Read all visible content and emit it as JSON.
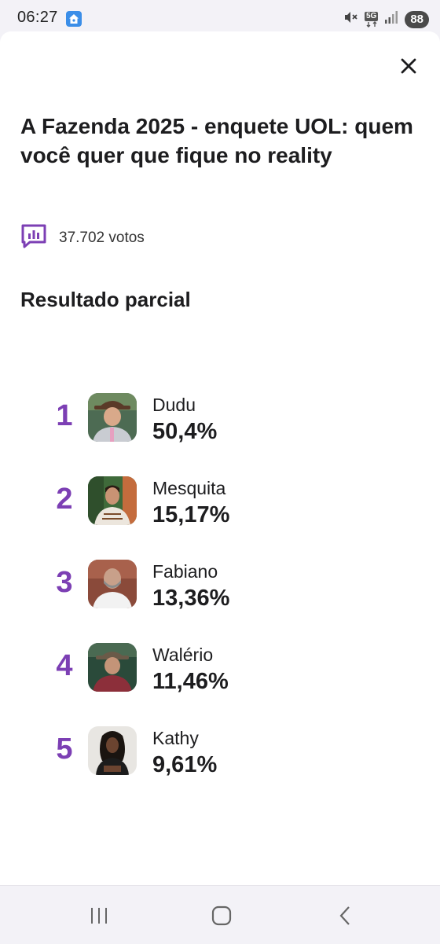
{
  "status_bar": {
    "time": "06:27",
    "network": "5G",
    "battery": "88"
  },
  "poll": {
    "title": "A Fazenda 2025 - enquete UOL: quem você quer que fique no reality",
    "votes": "37.702 votos",
    "section_title": "Resultado parcial",
    "accent_color": "#7c3fb4",
    "results": [
      {
        "rank": "1",
        "name": "Dudu",
        "percent": "50,4%"
      },
      {
        "rank": "2",
        "name": "Mesquita",
        "percent": "15,17%"
      },
      {
        "rank": "3",
        "name": "Fabiano",
        "percent": "13,36%"
      },
      {
        "rank": "4",
        "name": "Walério",
        "percent": "11,46%"
      },
      {
        "rank": "5",
        "name": "Kathy",
        "percent": "9,61%"
      }
    ]
  },
  "icons": {
    "close": "close-icon",
    "votes": "bar-chart-icon",
    "nav_recent": "recent-apps-icon",
    "nav_home": "home-icon",
    "nav_back": "back-icon"
  }
}
